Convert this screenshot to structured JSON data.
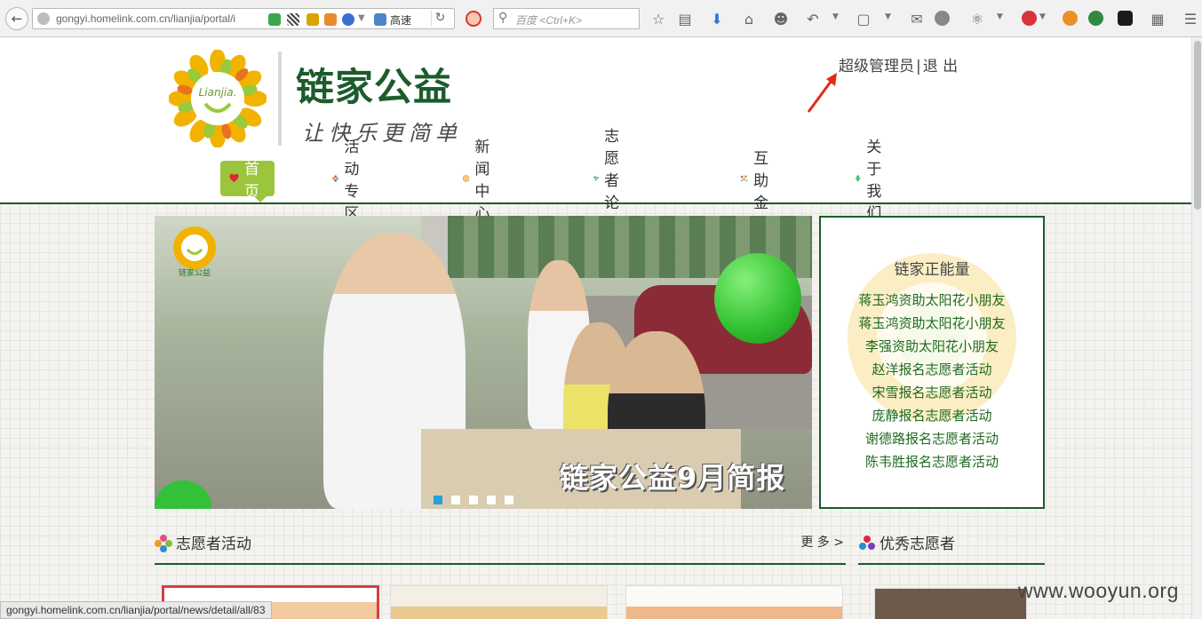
{
  "browser": {
    "url": "gongyi.homelink.com.cn/lianjia/portal/i",
    "speed_label": "高速",
    "search_placeholder": "百度 <Ctrl+K>",
    "status_url": "gongyi.homelink.com.cn/lianjia/portal/news/detail/all/83"
  },
  "header": {
    "logo_badge_text": "Lianjia.",
    "logo_title": "链家公益",
    "logo_slogan": "让快乐更简单",
    "user_name": "超级管理员",
    "separator": "|",
    "logout": "退  出"
  },
  "nav": [
    {
      "label": "首 页",
      "icon": "heart-icon",
      "color": "#e0263a",
      "active": true
    },
    {
      "label": "活动专区",
      "icon": "flower-icon",
      "color": "#e84d8a",
      "active": false
    },
    {
      "label": "新闻中心",
      "icon": "spiral-icon",
      "color": "#f39a1e",
      "active": false
    },
    {
      "label": "志愿者论坛",
      "icon": "puzzle-icon",
      "color": "#2b8fd0",
      "active": false
    },
    {
      "label": "互助金",
      "icon": "star-cluster-icon",
      "color": "#7fbf3f",
      "active": false
    },
    {
      "label": "关于我们",
      "icon": "person-icon",
      "color": "#2bbf66",
      "active": false
    }
  ],
  "banner": {
    "caption": "链家公益9月简报",
    "badge_text": "链家公益",
    "slides": 5,
    "active_slide": 1
  },
  "energy": {
    "title": "链家正能量",
    "items": [
      "蒋玉鸿资助太阳花小朋友",
      "蒋玉鸿资助太阳花小朋友",
      "李强资助太阳花小朋友",
      "赵洋报名志愿者活动",
      "宋雪报名志愿者活动",
      "庞静报名志愿者活动",
      "谢德路报名志愿者活动",
      "陈韦胜报名志愿者活动"
    ]
  },
  "sections": {
    "volunteer_activities": {
      "title": "志愿者活动",
      "more": "更 多 >"
    },
    "excellent_volunteers": {
      "title": "优秀志愿者"
    }
  },
  "watermark": "www.wooyun.org",
  "colors": {
    "brand_green": "#1c5c2c",
    "nav_active": "#9bc53d",
    "list_green": "#1f6a22"
  }
}
